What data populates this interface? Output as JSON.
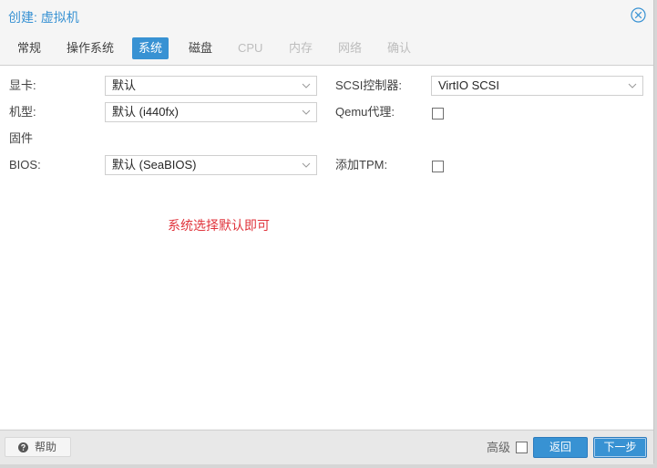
{
  "window": {
    "title": "创建: 虚拟机",
    "close_icon": "close-circle-icon"
  },
  "tabs": [
    {
      "label": "常规",
      "state": "normal"
    },
    {
      "label": "操作系统",
      "state": "normal"
    },
    {
      "label": "系统",
      "state": "active"
    },
    {
      "label": "磁盘",
      "state": "normal"
    },
    {
      "label": "CPU",
      "state": "disabled"
    },
    {
      "label": "内存",
      "state": "disabled"
    },
    {
      "label": "网络",
      "state": "disabled"
    },
    {
      "label": "确认",
      "state": "disabled"
    }
  ],
  "form": {
    "graphics_label": "显卡:",
    "graphics_value": "默认",
    "machine_label": "机型:",
    "machine_value": "默认 (i440fx)",
    "firmware_heading": "固件",
    "bios_label": "BIOS:",
    "bios_value": "默认 (SeaBIOS)",
    "scsi_label": "SCSI控制器:",
    "scsi_value": "VirtIO SCSI",
    "qemu_agent_label": "Qemu代理:",
    "qemu_agent_checked": false,
    "tpm_label": "添加TPM:",
    "tpm_checked": false
  },
  "annotation": {
    "text": "系统选择默认即可",
    "color": "#e0343c"
  },
  "footer": {
    "help_label": "帮助",
    "help_icon": "question-circle-icon",
    "advanced_label": "高级",
    "advanced_checked": false,
    "back_label": "返回",
    "next_label": "下一步"
  },
  "colors": {
    "accent": "#3892d3",
    "disabled_text": "#bdbdbd"
  }
}
